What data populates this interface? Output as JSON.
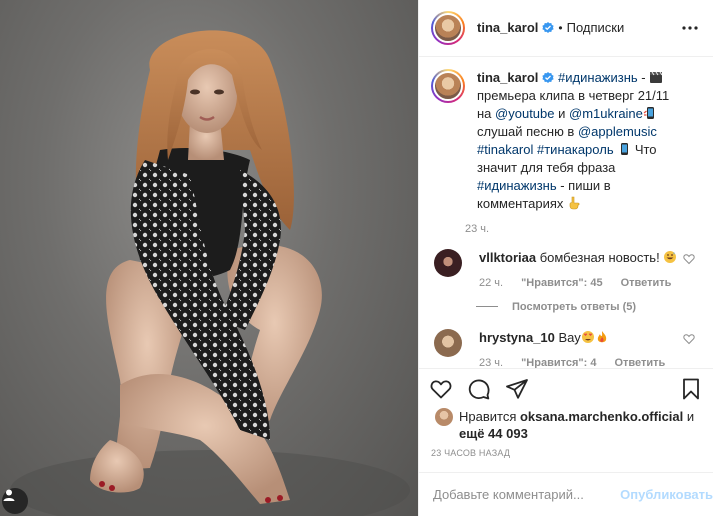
{
  "colors": {
    "accent_link": "#00376b",
    "verified": "#3897f0",
    "muted": "#8e8e8e",
    "publish_disabled": "#b3dbff"
  },
  "header": {
    "username": "tina_karol",
    "dot": "•",
    "follow_label": "Подписки",
    "verified_icon": "verified-badge-icon",
    "more_icon": "more-horizontal-icon"
  },
  "caption": {
    "username": "tina_karol",
    "text_1": " ",
    "tag_1": "#идинажизнь",
    "text_2": " - ",
    "emoji_1": "clapperboard-emoji",
    "text_3": " премьера клипа в четверг 21/11 на ",
    "mention_1": "@youtube",
    "text_4": " и ",
    "mention_2": "@m1ukraine",
    "emoji_2": "phone-emoji",
    "text_5": " слушай песню в ",
    "mention_3": "@applemusic",
    "text_6": " ",
    "tag_2": "#tinakarol",
    "tag_3": "#тинакароль",
    "emoji_3": "phone-emoji",
    "text_7": " Что значит для тебя фраза ",
    "tag_4": "#идинажизнь",
    "text_8": " - пиши в комментариях",
    "emoji_4": "pointing-down-emoji",
    "time": "23 ч."
  },
  "comments": [
    {
      "username": "vllktoriaa",
      "text": " бомбезная новость! ",
      "emoji": "grinning-sweat-emoji",
      "time": "22 ч.",
      "likes": "\"Нравится\": 45",
      "reply": "Ответить",
      "view_replies": "Посмотреть ответы (5)"
    },
    {
      "username": "hrystyna_10",
      "text": " Вау",
      "emoji": "heart-eyes-fire-emoji",
      "time": "23 ч.",
      "likes": "\"Нравится\": 4",
      "reply": "Ответить"
    }
  ],
  "actions": {
    "like_icon": "heart-icon",
    "comment_icon": "comment-icon",
    "share_icon": "share-icon",
    "save_icon": "bookmark-icon"
  },
  "likes": {
    "prefix": "Нравится ",
    "user": "oksana.marchenko.official",
    "middle": " и ",
    "count": "ещё 44 093"
  },
  "timestamp": "23 ЧАСОВ НАЗАД",
  "add_comment": {
    "placeholder": "Добавьте комментарий...",
    "publish": "Опубликовать"
  }
}
